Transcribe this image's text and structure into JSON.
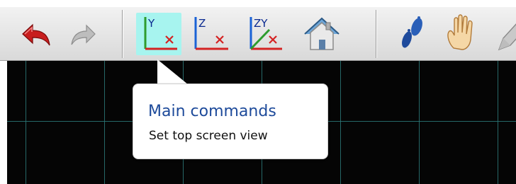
{
  "toolbar": {
    "buttons": [
      {
        "name": "undo",
        "icon": "undo-icon"
      },
      {
        "name": "redo",
        "icon": "redo-icon"
      },
      {
        "name": "top-view",
        "icon": "axis-xy-icon",
        "axis_label": "Y"
      },
      {
        "name": "front-view",
        "icon": "axis-xz-icon",
        "axis_label": "Z"
      },
      {
        "name": "iso-view",
        "icon": "axis-xyz-icon",
        "axis_label": "ZY"
      },
      {
        "name": "home-view",
        "icon": "home-icon"
      },
      {
        "name": "walk",
        "icon": "footprints-icon"
      },
      {
        "name": "pan",
        "icon": "hand-icon"
      },
      {
        "name": "draw",
        "icon": "pencil-icon"
      }
    ],
    "active_color": "#a7f4ef"
  },
  "tooltip": {
    "title": "Main commands",
    "description": "Set top screen view"
  },
  "colors": {
    "viewport_bg": "#050505",
    "grid": "#2c7878",
    "tooltip_title": "#1d4a9a"
  }
}
